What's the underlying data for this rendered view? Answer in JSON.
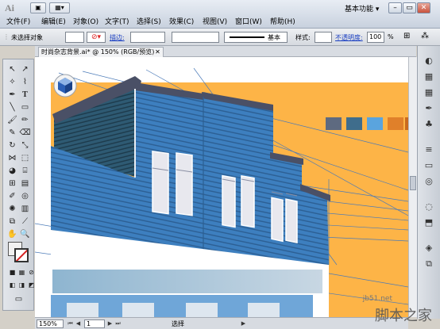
{
  "app": {
    "logo": "Ai",
    "workspace": "基本功能"
  },
  "menu": [
    "文件(F)",
    "编辑(E)",
    "对象(O)",
    "文字(T)",
    "选择(S)",
    "效果(C)",
    "视图(V)",
    "窗口(W)",
    "帮助(H)"
  ],
  "control": {
    "selection": "未选择对象",
    "stroke_label": "描边:",
    "brush": "基本",
    "style_label": "样式:",
    "opacity_label": "不透明度:",
    "opacity_value": "100",
    "opacity_unit": "%"
  },
  "document": {
    "tab_title": "时尚杂志背景.ai* @ 150% (RGB/预览)"
  },
  "status": {
    "zoom": "150%",
    "page": "1",
    "tool": "选择"
  },
  "swatches": [
    "#5e6a80",
    "#3f6d8c",
    "#5aa4de",
    "#e0802a",
    "#c96a1e"
  ],
  "colors": {
    "background": "#fdb447",
    "siding": "#3d7fbf",
    "trim": "#4a5066"
  },
  "watermark": {
    "url": "jb51.net",
    "text": "脚本之家"
  }
}
